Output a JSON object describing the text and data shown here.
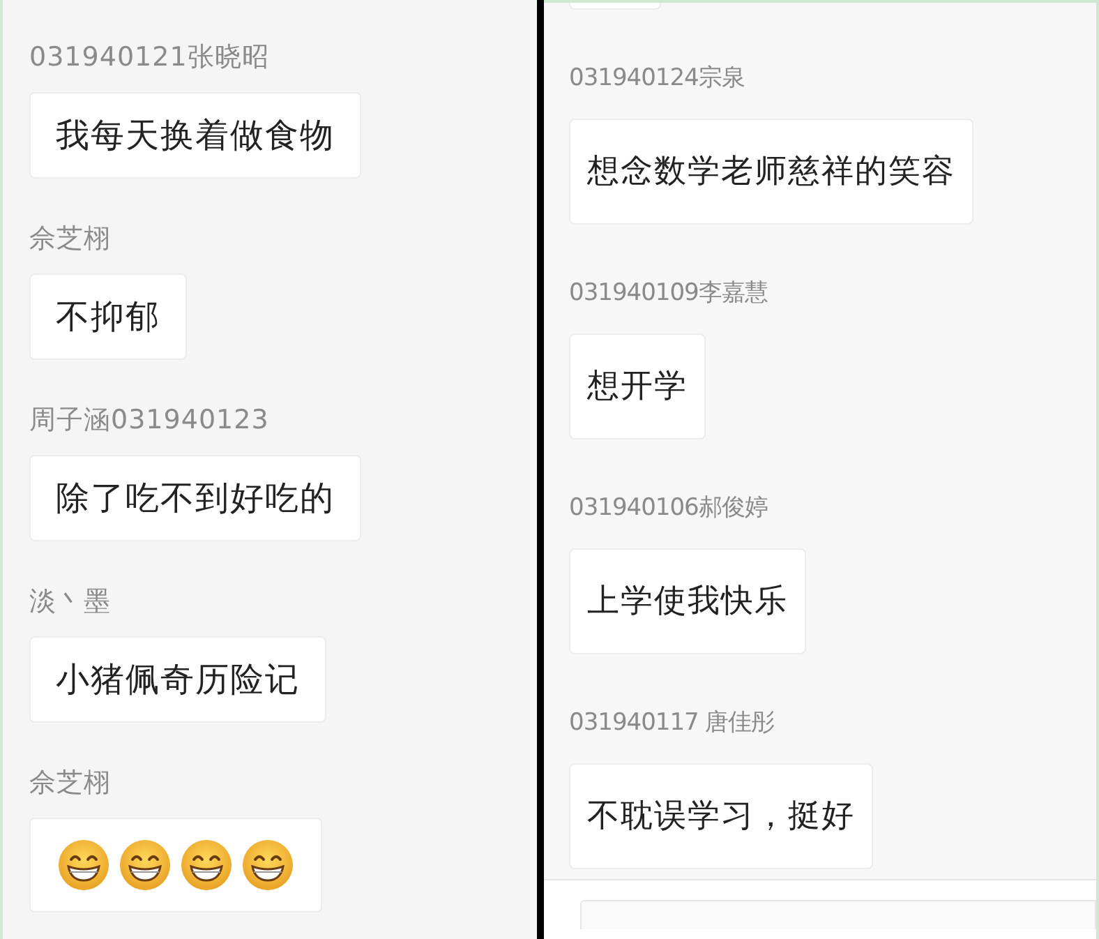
{
  "left_chat": {
    "messages": [
      {
        "sender": "031940121张晓昭",
        "kind": "text",
        "text": "我每天换着做食物"
      },
      {
        "sender": "佘芝栩",
        "kind": "text",
        "text": "不抑郁"
      },
      {
        "sender": "周子涵031940123",
        "kind": "text",
        "text": "除了吃不到好吃的"
      },
      {
        "sender": "淡丶墨",
        "kind": "text",
        "text": "小猪佩奇历险记"
      },
      {
        "sender": "佘芝栩",
        "kind": "emoji",
        "emojis": [
          {
            "kind": "grin"
          },
          {
            "kind": "grin"
          },
          {
            "kind": "grin"
          },
          {
            "kind": "grin"
          }
        ]
      }
    ]
  },
  "right_chat": {
    "messages": [
      {
        "sender": "031940124宗泉",
        "kind": "text",
        "text": "想念数学老师慈祥的笑容"
      },
      {
        "sender": "031940109李嘉慧",
        "kind": "text",
        "text": "想开学"
      },
      {
        "sender": "031940106郝俊婷",
        "kind": "text",
        "text": "上学使我快乐"
      },
      {
        "sender": "031940117 唐佳彤",
        "kind": "text",
        "text": "不耽误学习，挺好"
      }
    ]
  }
}
